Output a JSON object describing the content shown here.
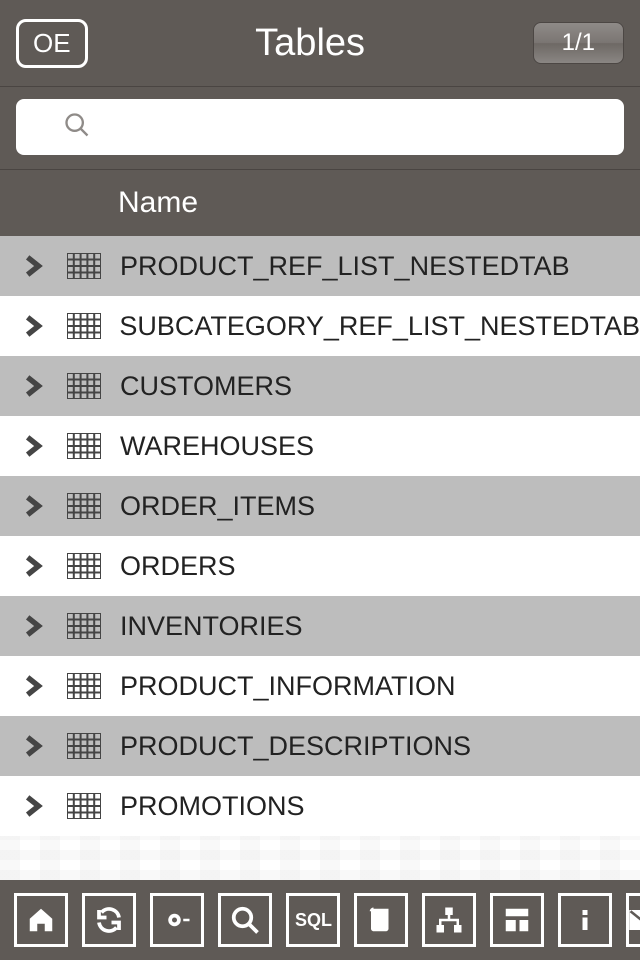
{
  "header": {
    "schema_label": "OE",
    "title": "Tables",
    "page_indicator": "1/1"
  },
  "search": {
    "value": "",
    "placeholder": ""
  },
  "columns": {
    "name_header": "Name"
  },
  "tables": [
    {
      "name": "PRODUCT_REF_LIST_NESTEDTAB"
    },
    {
      "name": "SUBCATEGORY_REF_LIST_NESTEDTAB"
    },
    {
      "name": "CUSTOMERS"
    },
    {
      "name": "WAREHOUSES"
    },
    {
      "name": "ORDER_ITEMS"
    },
    {
      "name": "ORDERS"
    },
    {
      "name": "INVENTORIES"
    },
    {
      "name": "PRODUCT_INFORMATION"
    },
    {
      "name": "PRODUCT_DESCRIPTIONS"
    },
    {
      "name": "PROMOTIONS"
    }
  ],
  "toolbar": {
    "icons": [
      "home-icon",
      "refresh-icon",
      "settings-icon",
      "search-icon",
      "sql-icon",
      "scroll-icon",
      "structure-icon",
      "layout-icon",
      "info-icon",
      "mail-icon"
    ],
    "sql_label": "SQL"
  }
}
